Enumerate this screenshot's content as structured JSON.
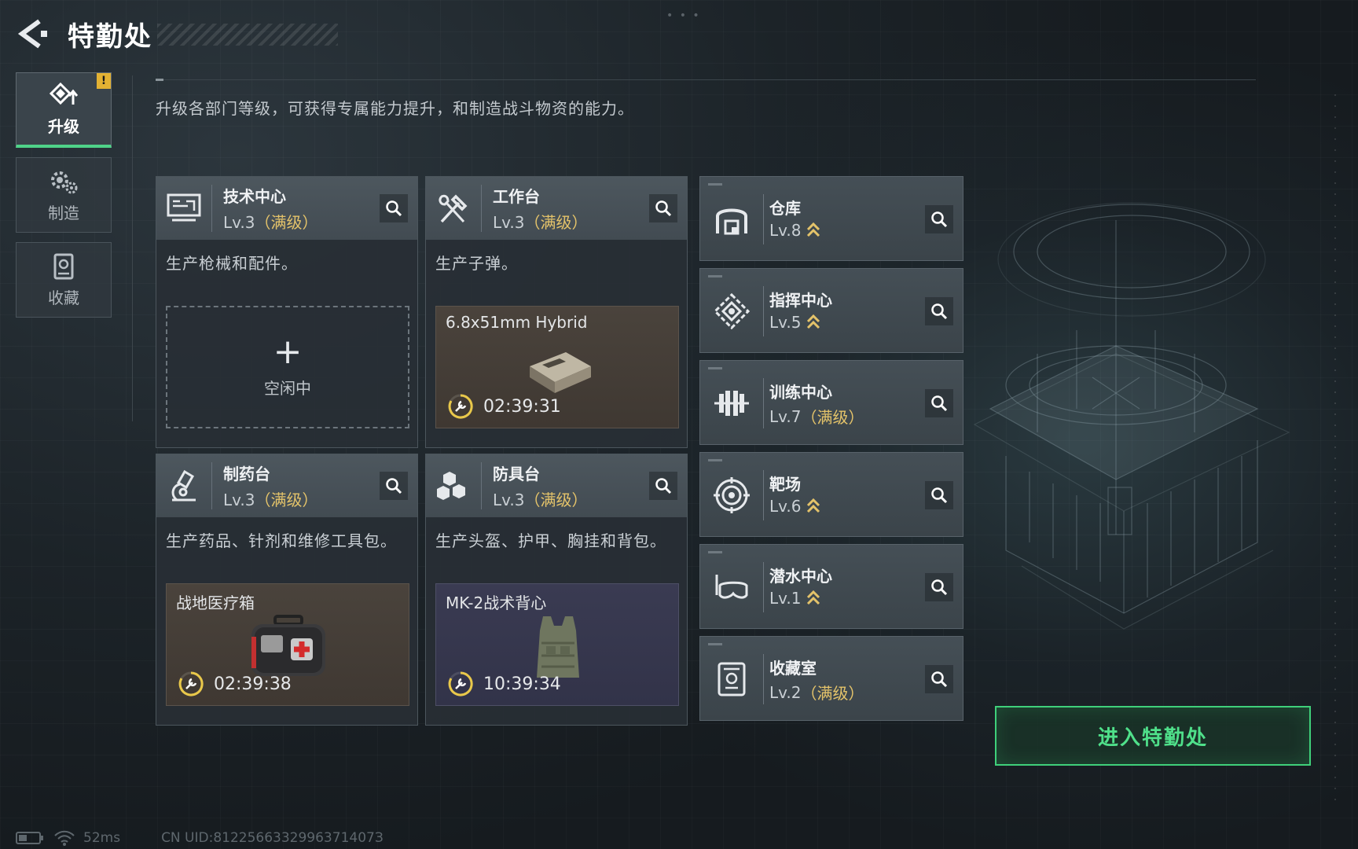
{
  "header": {
    "title": "特勤处"
  },
  "sidebar": {
    "tabs": [
      {
        "label": "升级",
        "icon": "upgrade-icon",
        "active": true,
        "badge": "!"
      },
      {
        "label": "制造",
        "icon": "gears-icon",
        "active": false
      },
      {
        "label": "收藏",
        "icon": "collection-icon",
        "active": false
      }
    ]
  },
  "description": "升级各部门等级，可获得专属能力提升，和制造战斗物资的能力。",
  "depts": [
    {
      "name": "技术中心",
      "level": "Lv.3",
      "maxed": "（满级）",
      "desc": "生产枪械和配件。",
      "slot_state": "empty",
      "plus": "+",
      "idle": "空闲中"
    },
    {
      "name": "工作台",
      "level": "Lv.3",
      "maxed": "（满级）",
      "desc": "生产子弹。",
      "slot_state": "producing",
      "item": "6.8x51mm Hybrid",
      "timer": "02:39:31"
    },
    {
      "name": "制药台",
      "level": "Lv.3",
      "maxed": "（满级）",
      "desc": "生产药品、针剂和维修工具包。",
      "slot_state": "producing",
      "item": "战地医疗箱",
      "timer": "02:39:38"
    },
    {
      "name": "防具台",
      "level": "Lv.3",
      "maxed": "（满级）",
      "desc": "生产头盔、护甲、胸挂和背包。",
      "slot_state": "producing",
      "item": "MK-2战术背心",
      "timer": "10:39:34"
    }
  ],
  "facilities": [
    {
      "name": "仓库",
      "level": "Lv.8",
      "maxed": "",
      "upgradable": true,
      "icon": "warehouse-icon"
    },
    {
      "name": "指挥中心",
      "level": "Lv.5",
      "maxed": "",
      "upgradable": true,
      "icon": "command-icon"
    },
    {
      "name": "训练中心",
      "level": "Lv.7",
      "maxed": "（满级）",
      "upgradable": false,
      "icon": "dumbbell-icon"
    },
    {
      "name": "靶场",
      "level": "Lv.6",
      "maxed": "",
      "upgradable": true,
      "icon": "target-icon"
    },
    {
      "name": "潜水中心",
      "level": "Lv.1",
      "maxed": "",
      "upgradable": true,
      "icon": "diving-mask-icon"
    },
    {
      "name": "收藏室",
      "level": "Lv.2",
      "maxed": "（满级）",
      "upgradable": false,
      "icon": "collection-room-icon"
    }
  ],
  "enter_button": "进入特勤处",
  "footer": {
    "ping": "52ms",
    "uid": "CN UID:8122566332996371407З"
  },
  "colors": {
    "accent": "#4fd389",
    "gold": "#e4c36a",
    "badge": "#e3b233"
  }
}
